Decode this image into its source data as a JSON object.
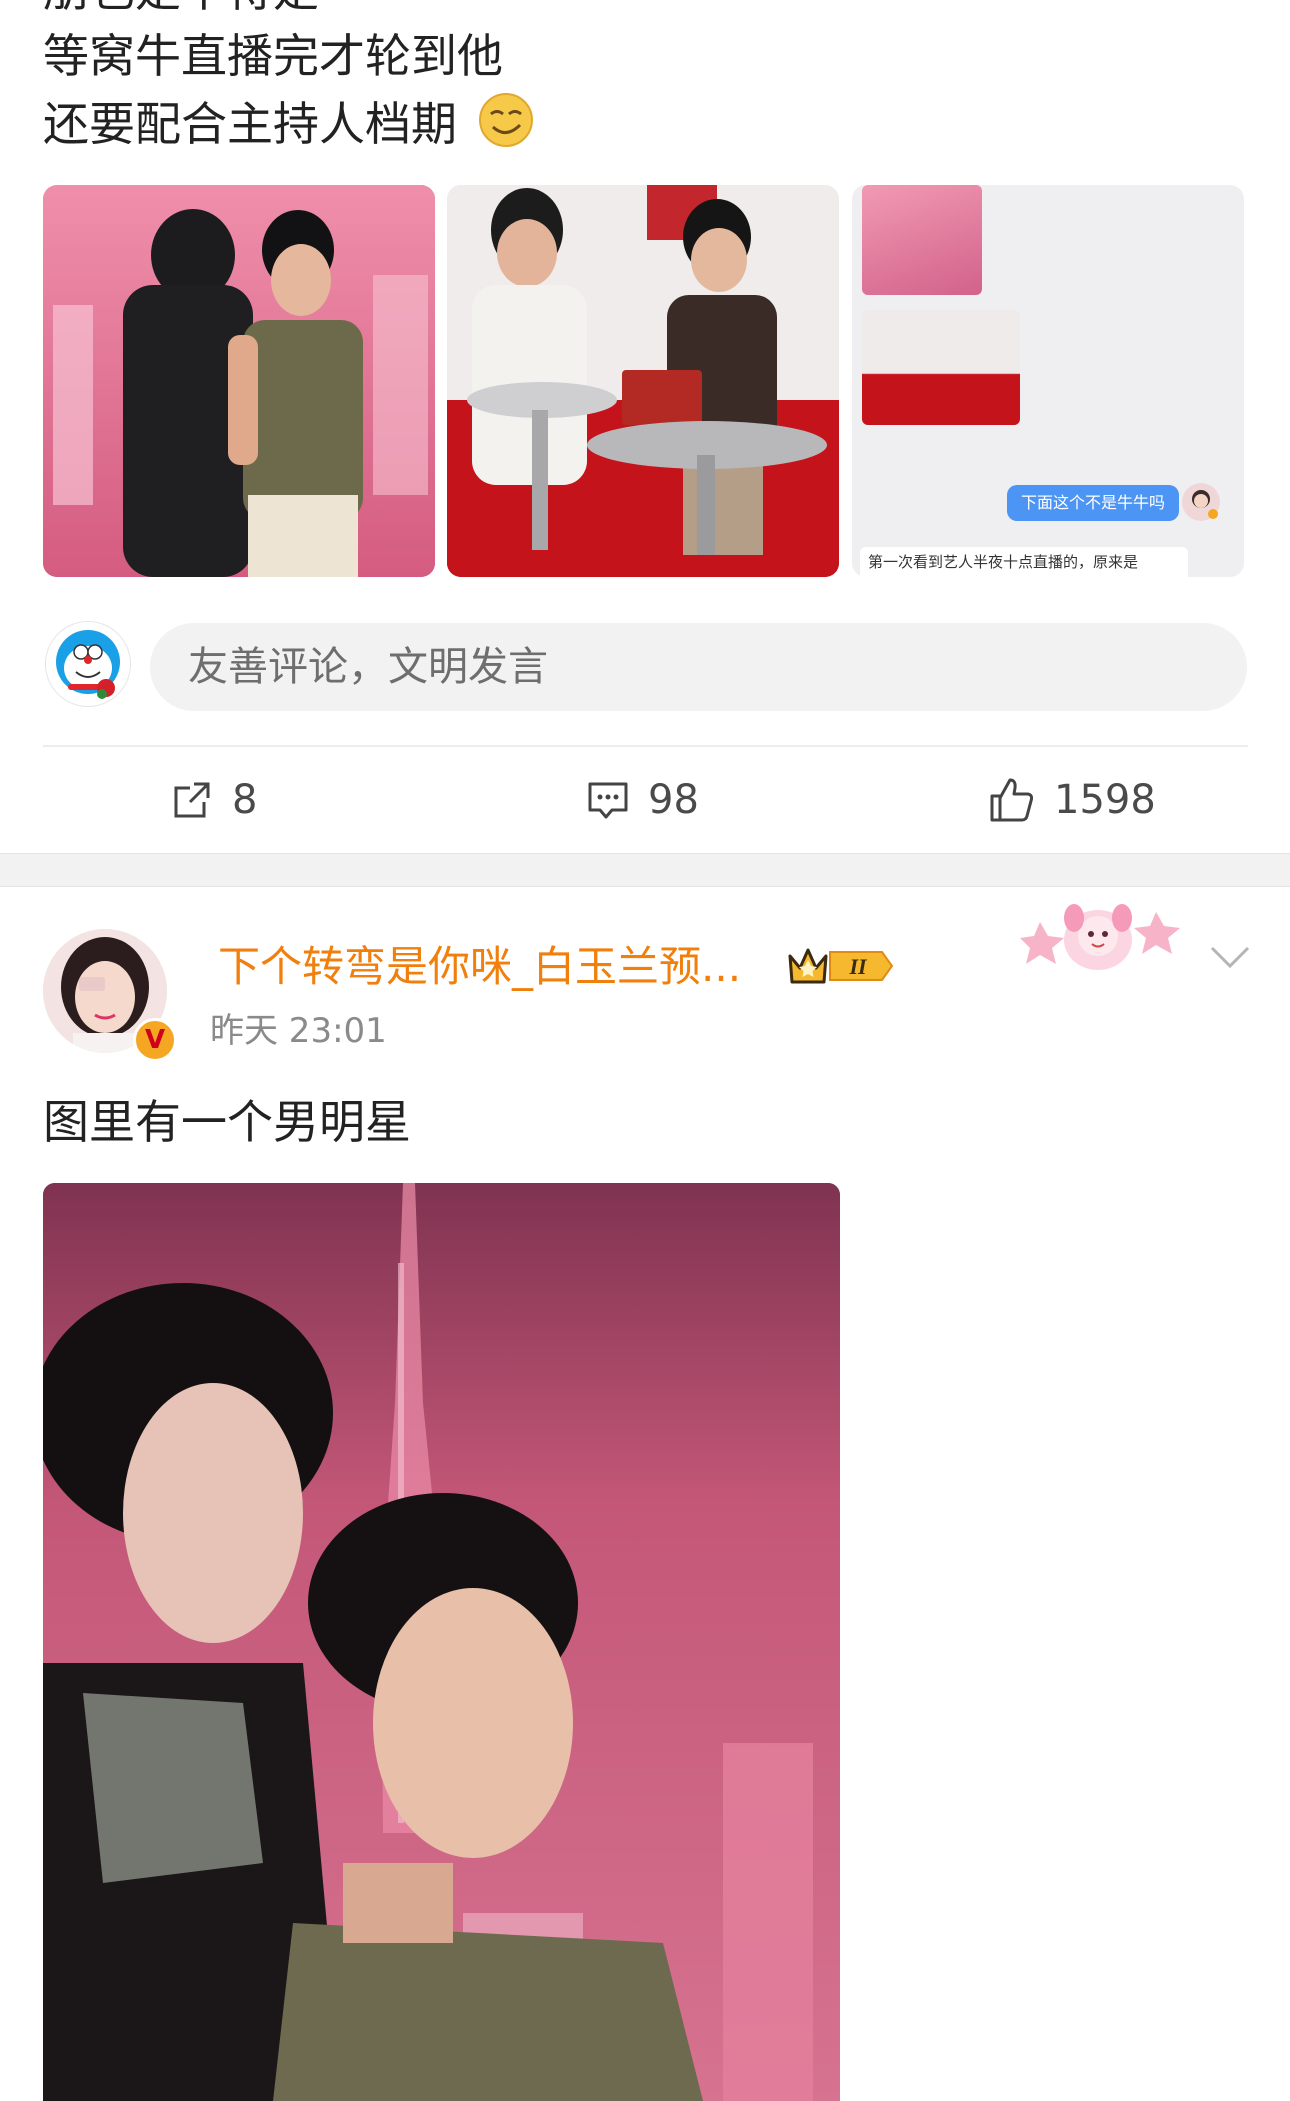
{
  "post1": {
    "text_cut": "朋也是半待是",
    "text_lines": [
      "等窝牛直播完才轮到他",
      "还要配合主持人档期"
    ],
    "emoji": "smirk-emoji",
    "thumb3": {
      "chat_bubble": "下面这个不是牛牛吗",
      "caption": "第一次看到艺人半夜十点直播的，原来是"
    },
    "comment_placeholder": "友善评论，文明发言",
    "actions": {
      "repost_count": "8",
      "comment_count": "98",
      "like_count": "1598"
    }
  },
  "post2": {
    "username": "下个转弯是你咪_白玉兰预...",
    "badge_level": "II",
    "timestamp": "昨天 23:01",
    "text": "图里有一个男明星"
  },
  "colors": {
    "username": "#f07f0c",
    "chat_bubble": "#4d95f5",
    "verified_badge": "#f5a623"
  }
}
